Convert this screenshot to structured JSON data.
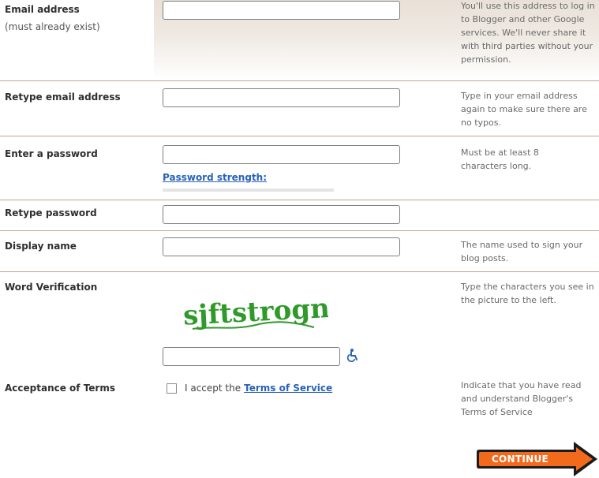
{
  "rows": {
    "email": {
      "label": "Email address",
      "sublabel": "(must already exist)",
      "value": "",
      "hint": "You'll use this address to log in to Blogger and other Google services. We'll never share it with third parties without your permission."
    },
    "retype_email": {
      "label": "Retype email address",
      "value": "",
      "hint": "Type in your email address again to make sure there are no typos."
    },
    "password": {
      "label": "Enter a password",
      "value": "",
      "strength_label": "Password strength:",
      "hint": "Must be at least 8 characters long."
    },
    "retype_password": {
      "label": "Retype password",
      "value": ""
    },
    "display_name": {
      "label": "Display name",
      "value": "",
      "hint": "The name used to sign your blog posts."
    },
    "word_verification": {
      "label": "Word Verification",
      "captcha_text": "sjftstrogn",
      "value": "",
      "hint": "Type the characters you see in the picture to the left."
    },
    "terms": {
      "label": "Acceptance of Terms",
      "checkbox_text": "I accept the",
      "link_text": "Terms of Service",
      "checked": false,
      "hint": "Indicate that you have read and understand Blogger's Terms of Service"
    }
  },
  "continue_button": {
    "label": "CONTINUE"
  },
  "icons": {
    "accessibility": "wheelchair-icon",
    "continue_arrow": "arrow-right-icon"
  },
  "colors": {
    "accent_orange": "#f26b1d",
    "link_blue": "#2a62b8",
    "captcha_green": "#2f9a2a",
    "row_divider": "#b8a79a"
  }
}
